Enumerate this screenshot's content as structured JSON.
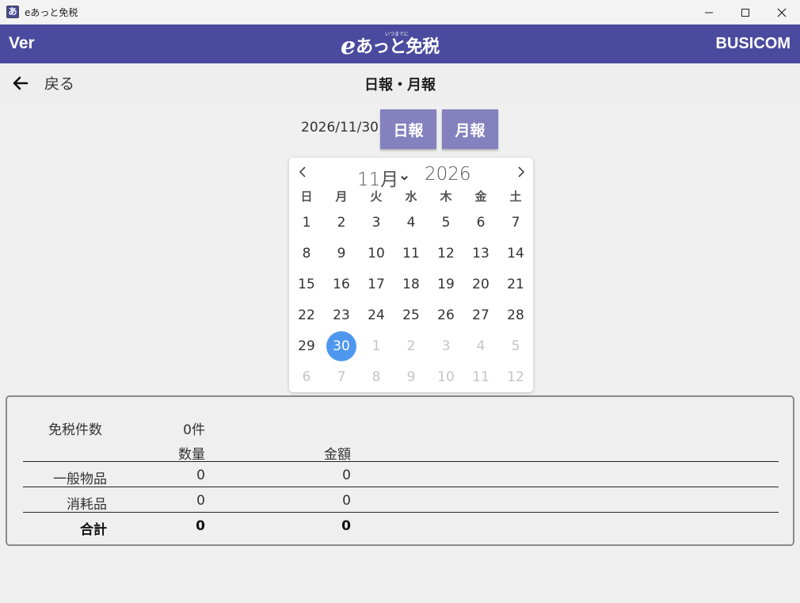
{
  "window": {
    "title": "eあっと免税"
  },
  "brand": {
    "version_label": "Ver",
    "logo_e": "e",
    "logo_text": "あっと免税",
    "logo_small": "いつまでに",
    "company": "BUSICOM"
  },
  "nav": {
    "back_label": "戻る",
    "title": "日報・月報"
  },
  "report": {
    "date": "2026/11/30",
    "daily_label": "日報",
    "monthly_label": "月報"
  },
  "calendar": {
    "month": "11月",
    "year": "2026",
    "weekdays": [
      "日",
      "月",
      "火",
      "水",
      "木",
      "金",
      "土"
    ],
    "weeks": [
      [
        "1",
        "2",
        "3",
        "4",
        "5",
        "6",
        "7"
      ],
      [
        "8",
        "9",
        "10",
        "11",
        "12",
        "13",
        "14"
      ],
      [
        "15",
        "16",
        "17",
        "18",
        "19",
        "20",
        "21"
      ],
      [
        "22",
        "23",
        "24",
        "25",
        "26",
        "27",
        "28"
      ],
      [
        "29",
        "30",
        "1",
        "2",
        "3",
        "4",
        "5"
      ],
      [
        "6",
        "7",
        "8",
        "9",
        "10",
        "11",
        "12"
      ]
    ],
    "selected": "30",
    "accent_color": "#4f97ee"
  },
  "summary": {
    "count_label": "免税件数",
    "count_value": "0件",
    "col_quantity": "数量",
    "col_amount": "金額",
    "rows": [
      {
        "label": "一般物品",
        "quantity": "0",
        "amount": "0"
      },
      {
        "label": "消耗品",
        "quantity": "0",
        "amount": "0"
      }
    ],
    "total": {
      "label": "合計",
      "quantity": "0",
      "amount": "0"
    }
  },
  "colors": {
    "header": "#4a4a9e",
    "button": "#8481be"
  }
}
